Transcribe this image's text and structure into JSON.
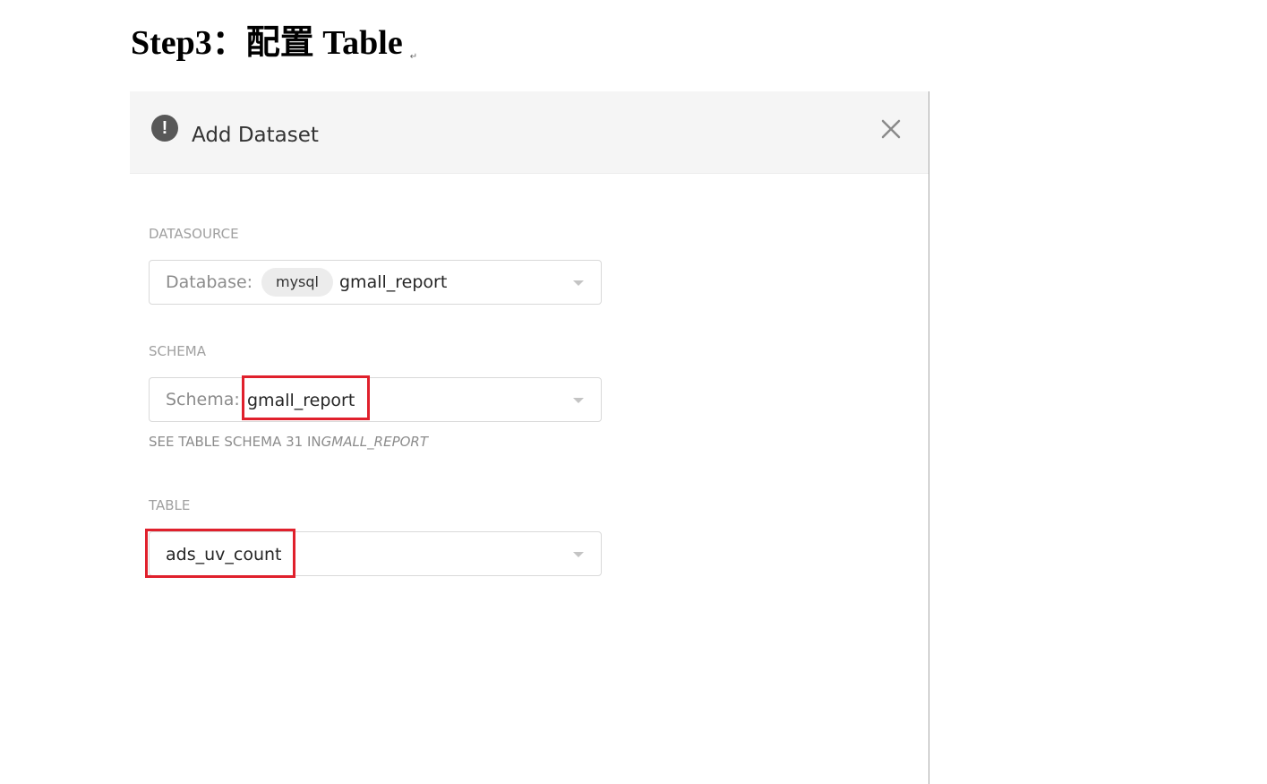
{
  "doc": {
    "heading": "Step3：配置 Table",
    "paragraph_mark": "↵"
  },
  "modal": {
    "title": "Add Dataset",
    "alert_icon_glyph": "!",
    "close_icon": "close-icon"
  },
  "datasource": {
    "label": "DATASOURCE",
    "prefix": "Database:",
    "engine_badge": "mysql",
    "value": "gmall_report"
  },
  "schema": {
    "label": "SCHEMA",
    "prefix": "Schema:",
    "value": "gmall_report",
    "hint_text": "SEE TABLE SCHEMA 31 IN",
    "hint_schema": "GMALL_REPORT"
  },
  "table": {
    "label": "TABLE",
    "value": "ads_uv_count"
  },
  "colors": {
    "annotation_red": "#e0202c",
    "header_bg": "#f5f5f5"
  }
}
